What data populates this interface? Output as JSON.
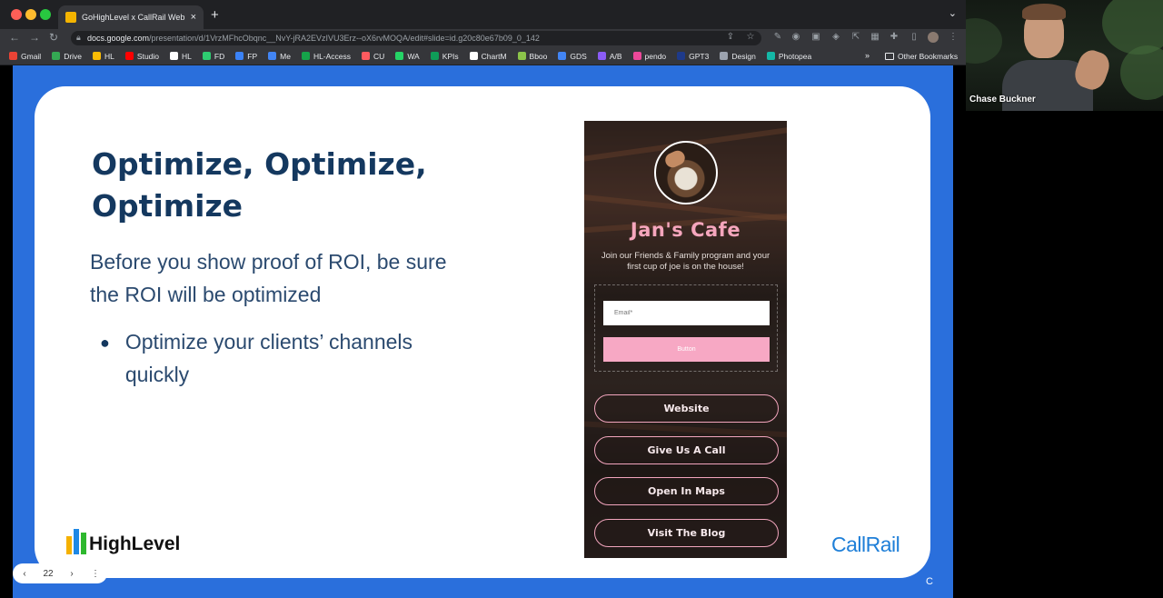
{
  "browser": {
    "tab_title": "GoHighLevel x CallRail Webina",
    "tab_close": "×",
    "new_tab": "+",
    "url_host": "docs.google.com",
    "url_path": "/presentation/d/1VrzMFhcObqnc__NvY-jRA2EVzIVU3Erz--oX6rvMOQA/edit#slide=id.g20c80e67b09_0_142",
    "bookmarks": [
      {
        "label": "Gmail",
        "color": "#ea4335"
      },
      {
        "label": "Drive",
        "color": "#34a853"
      },
      {
        "label": "HL",
        "color": "#fbbc05"
      },
      {
        "label": "Studio",
        "color": "#ff0000"
      },
      {
        "label": "HL",
        "color": "#ffffff"
      },
      {
        "label": "FD",
        "color": "#2ecc71"
      },
      {
        "label": "FP",
        "color": "#3b82f6"
      },
      {
        "label": "Me",
        "color": "#4285f4"
      },
      {
        "label": "HL-Access",
        "color": "#16a34a"
      },
      {
        "label": "CU",
        "color": "#ff5a5f"
      },
      {
        "label": "WA",
        "color": "#25d366"
      },
      {
        "label": "KPIs",
        "color": "#0f9d58"
      },
      {
        "label": "ChartM",
        "color": "#ffffff"
      },
      {
        "label": "Bboo",
        "color": "#8bc34a"
      },
      {
        "label": "GDS",
        "color": "#4285f4"
      },
      {
        "label": "A/B",
        "color": "#8b5cf6"
      },
      {
        "label": "pendo",
        "color": "#ec4899"
      },
      {
        "label": "GPT3",
        "color": "#1e3a8a"
      },
      {
        "label": "Design",
        "color": "#9ca3af"
      },
      {
        "label": "Photopea",
        "color": "#14b8a6"
      }
    ],
    "bookmarks_more": "»",
    "other_bookmarks": "Other Bookmarks"
  },
  "slide": {
    "title": "Optimize, Optimize, Optimize",
    "body": "Before you show proof of ROI, be sure the ROI will  be optimized",
    "bullet": "Optimize your clients’ channels quickly",
    "bullet_dot": "●",
    "highlevel_logo_text": "HighLevel",
    "callrail_logo_text": "CallRail",
    "corner_mark": "C"
  },
  "phone": {
    "cafe_name": "Jan's Cafe",
    "description": "Join our Friends & Family program and your first cup of joe is on the house!",
    "email_placeholder": "Email*",
    "button_label": "Button",
    "links": [
      "Website",
      "Give Us A Call",
      "Open In Maps",
      "Visit The Blog"
    ]
  },
  "slide_nav": {
    "prev": "‹",
    "page": "22",
    "next": "›",
    "menu": "⋮"
  },
  "video": {
    "participant_name": "Chase Buckner"
  },
  "colors": {
    "stage_blue": "#2a6fdc",
    "title_navy": "#14385f",
    "cafe_pink": "#f6a6bd",
    "callrail_blue": "#1f7fd8"
  }
}
